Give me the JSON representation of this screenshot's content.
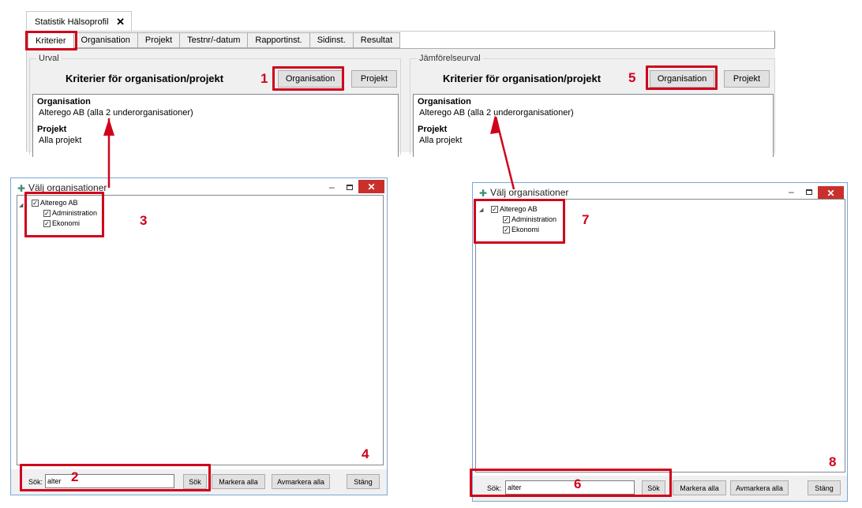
{
  "main": {
    "doc_tab": "Statistik Hälsoprofil",
    "doc_tab_close": "✕",
    "tabs": [
      "Kriterier",
      "Organisation",
      "Projekt",
      "Testnr/-datum",
      "Rapportinst.",
      "Sidinst.",
      "Resultat"
    ],
    "left_group": {
      "title": "Urval",
      "heading": "Kriterier för organisation/projekt",
      "org_button": "Organisation",
      "proj_button": "Projekt",
      "org_label": "Organisation",
      "org_value": "Alterego AB (alla 2 underorganisationer)",
      "proj_label": "Projekt",
      "proj_value": "Alla projekt"
    },
    "right_group": {
      "title": "Jämförelseurval",
      "heading": "Kriterier för organisation/projekt",
      "org_button": "Organisation",
      "proj_button": "Projekt",
      "org_label": "Organisation",
      "org_value": "Alterego AB (alla 2 underorganisationer)",
      "proj_label": "Projekt",
      "proj_value": "Alla projekt"
    }
  },
  "dialogs": [
    {
      "title": "Välj organisationer",
      "tree": {
        "root": "Alterego AB",
        "children": [
          "Administration",
          "Ekonomi"
        ]
      },
      "search_label": "Sök:",
      "search_value": "alter",
      "search_button": "Sök",
      "select_all": "Markera alla",
      "deselect_all": "Avmarkera alla",
      "close_button": "Stäng"
    },
    {
      "title": "Välj organisationer",
      "tree": {
        "root": "Alterego AB",
        "children": [
          "Administration",
          "Ekonomi"
        ]
      },
      "search_label": "Sök:",
      "search_value": "alter",
      "search_button": "Sök",
      "select_all": "Markera alla",
      "deselect_all": "Avmarkera alla",
      "close_button": "Stäng"
    }
  ],
  "annotations": [
    "1",
    "2",
    "3",
    "4",
    "5",
    "6",
    "7",
    "8"
  ],
  "colors": {
    "highlight": "#d0021b",
    "close": "#c9302c",
    "panel": "#f0f0f0"
  }
}
